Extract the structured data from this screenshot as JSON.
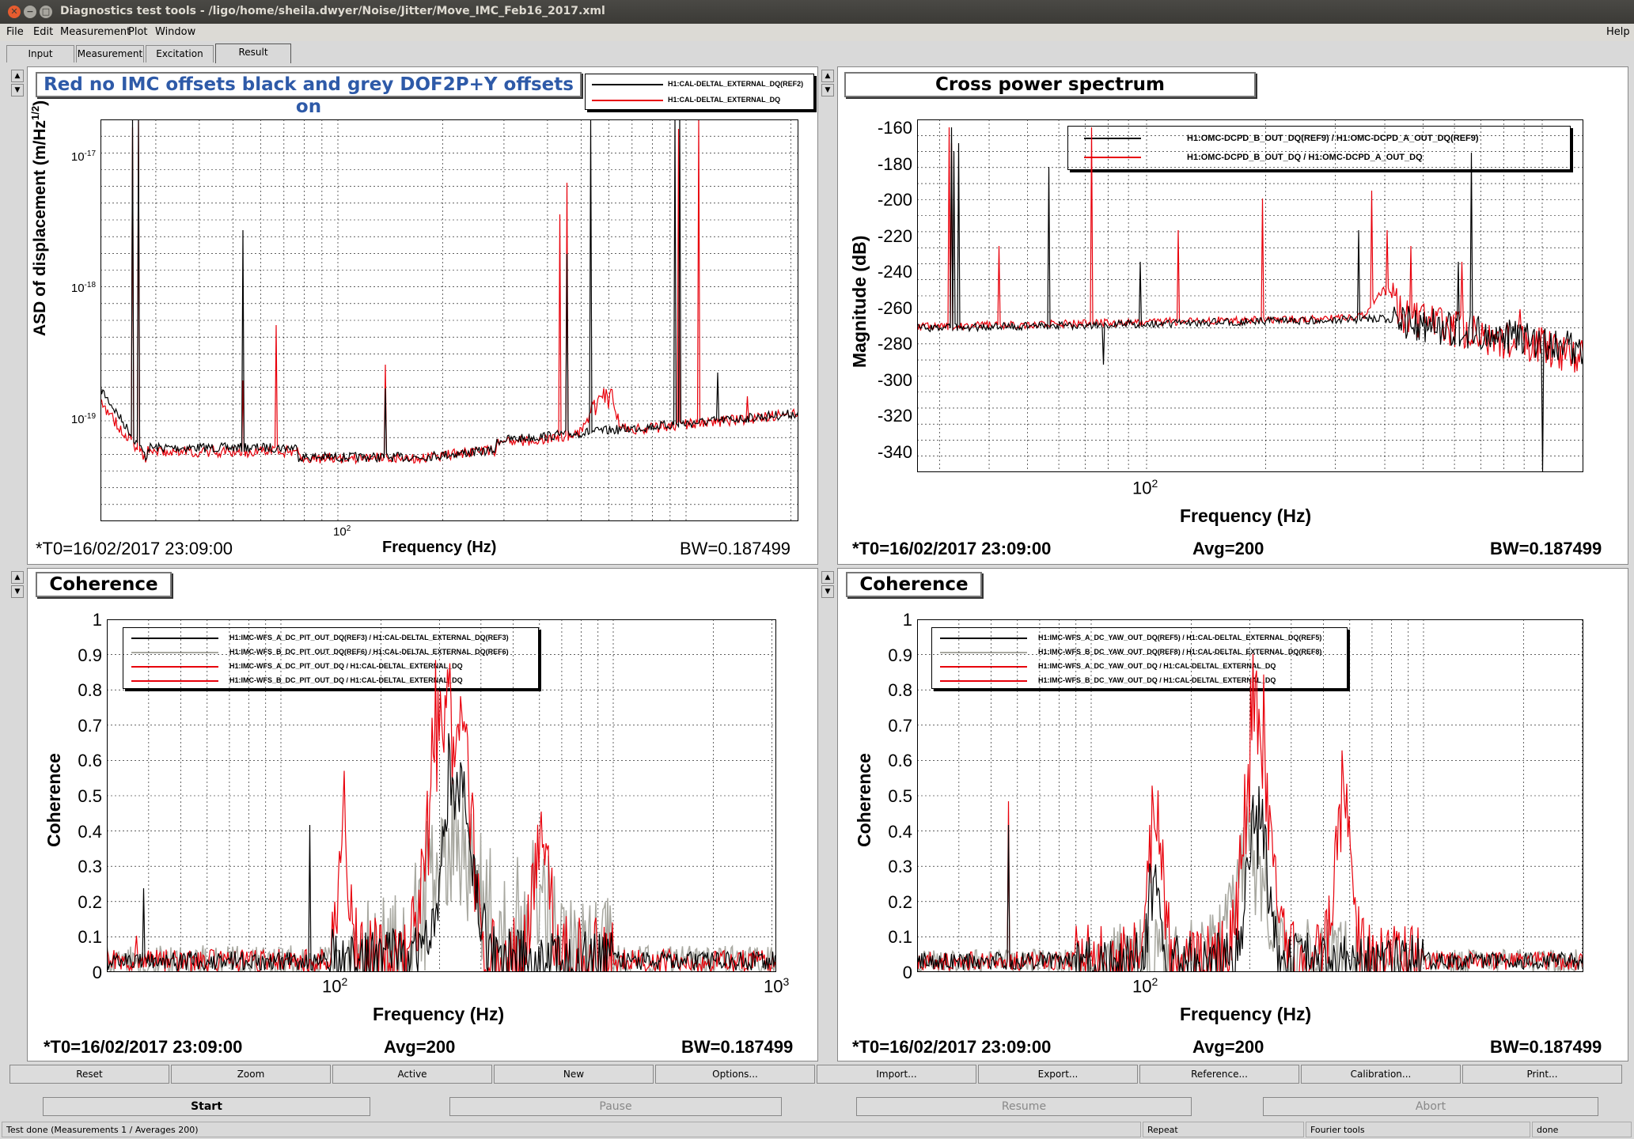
{
  "window": {
    "title": "Diagnostics test tools - /ligo/home/sheila.dwyer/Noise/Jitter/Move_IMC_Feb16_2017.xml"
  },
  "menu": [
    "File",
    "Edit",
    "Measurement",
    "Plot",
    "Window"
  ],
  "help_label": "Help",
  "tabs": [
    "Input",
    "Measurement",
    "Excitation",
    "Result"
  ],
  "panels": {
    "tl": {
      "title": "Red no IMC offsets black and grey DOF2P+Y offsets on",
      "ylabel": "ASD of displacement (m/Hz^1/2)",
      "xlabel": "Frequency (Hz)",
      "t0": "*T0=16/02/2017 23:09:00",
      "bw": "BW=0.187499",
      "legend": [
        "H1:CAL-DELTAL_EXTERNAL_DQ(REF2)",
        "H1:CAL-DELTAL_EXTERNAL_DQ"
      ],
      "yticks": [
        "10",
        "10",
        "10"
      ],
      "yexp": [
        "-17",
        "-18",
        "-19"
      ],
      "xticks": [
        "10"
      ],
      "xexp": [
        "2"
      ]
    },
    "tr": {
      "title": "Cross power spectrum",
      "ylabel": "Magnitude (dB)",
      "xlabel": "Frequency (Hz)",
      "t0": "*T0=16/02/2017 23:09:00",
      "avg": "Avg=200",
      "bw": "BW=0.187499",
      "legend": [
        "H1:OMC-DCPD_B_OUT_DQ(REF9) / H1:OMC-DCPD_A_OUT_DQ(REF9)",
        "H1:OMC-DCPD_B_OUT_DQ / H1:OMC-DCPD_A_OUT_DQ"
      ],
      "yticks": [
        "-160",
        "-180",
        "-200",
        "-220",
        "-240",
        "-260",
        "-280",
        "-300",
        "-320",
        "-340"
      ],
      "xticks": [
        "10"
      ],
      "xexp": [
        "2"
      ]
    },
    "bl": {
      "title": "Coherence",
      "ylabel": "Coherence",
      "xlabel": "Frequency (Hz)",
      "t0": "*T0=16/02/2017 23:09:00",
      "avg": "Avg=200",
      "bw": "BW=0.187499",
      "legend": [
        "H1:IMC-WFS_A_DC_PIT_OUT_DQ(REF3) / H1:CAL-DELTAL_EXTERNAL_DQ(REF3)",
        "H1:IMC-WFS_B_DC_PIT_OUT_DQ(REF6) / H1:CAL-DELTAL_EXTERNAL_DQ(REF6)",
        "H1:IMC-WFS_A_DC_PIT_OUT_DQ / H1:CAL-DELTAL_EXTERNAL_DQ",
        "H1:IMC-WFS_B_DC_PIT_OUT_DQ / H1:CAL-DELTAL_EXTERNAL_DQ"
      ],
      "yticks": [
        "1",
        "0.9",
        "0.8",
        "0.7",
        "0.6",
        "0.5",
        "0.4",
        "0.3",
        "0.2",
        "0.1",
        "0"
      ],
      "xticks": [
        "10",
        "10"
      ],
      "xexp": [
        "2",
        "3"
      ]
    },
    "br": {
      "title": "Coherence",
      "ylabel": "Coherence",
      "xlabel": "Frequency (Hz)",
      "t0": "*T0=16/02/2017 23:09:00",
      "avg": "Avg=200",
      "bw": "BW=0.187499",
      "legend": [
        "H1:IMC-WFS_A_DC_YAW_OUT_DQ(REF5) / H1:CAL-DELTAL_EXTERNAL_DQ(REF5)",
        "H1:IMC-WFS_B_DC_YAW_OUT_DQ(REF8) / H1:CAL-DELTAL_EXTERNAL_DQ(REF8)",
        "H1:IMC-WFS_A_DC_YAW_OUT_DQ / H1:CAL-DELTAL_EXTERNAL_DQ",
        "H1:IMC-WFS_B_DC_YAW_OUT_DQ / H1:CAL-DELTAL_EXTERNAL_DQ"
      ],
      "yticks": [
        "1",
        "0.9",
        "0.8",
        "0.7",
        "0.6",
        "0.5",
        "0.4",
        "0.3",
        "0.2",
        "0.1",
        "0"
      ],
      "xticks": [
        "10"
      ],
      "xexp": [
        "2"
      ]
    }
  },
  "controls": [
    "Reset",
    "Zoom",
    "Active",
    "New",
    "Options...",
    "Import...",
    "Export...",
    "Reference...",
    "Calibration...",
    "Print..."
  ],
  "big_buttons": [
    "Start",
    "Pause",
    "Resume",
    "Abort"
  ],
  "status": {
    "left": "Test done (Measurements 1 / Averages 200)",
    "repeat": "Repeat",
    "fourier": "Fourier tools",
    "done": "done"
  },
  "colors": {
    "ref_trace": "#000000",
    "live_trace": "#e8000b",
    "grey_trace": "#a8a8a0",
    "title_blue": "#2e5aa8"
  }
}
